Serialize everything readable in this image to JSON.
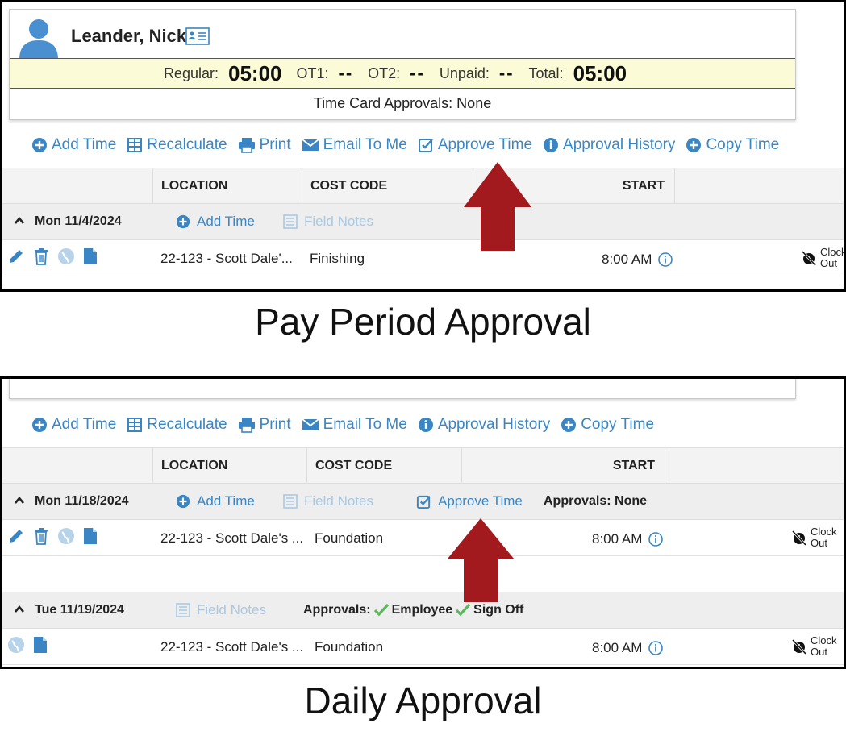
{
  "employee": {
    "name": "Leander, Nick",
    "regular_label": "Regular:",
    "regular_value": "05:00",
    "ot1_label": "OT1:",
    "ot1_value": "--",
    "ot2_label": "OT2:",
    "ot2_value": "--",
    "unpaid_label": "Unpaid:",
    "unpaid_value": "--",
    "total_label": "Total:",
    "total_value": "05:00",
    "approvals_line": "Time Card Approvals: None"
  },
  "toolbar1": {
    "add_time": "Add Time",
    "recalculate": "Recalculate",
    "print": "Print",
    "email_to_me": "Email To Me",
    "approve_time": "Approve Time",
    "approval_history": "Approval History",
    "copy_time": "Copy Time"
  },
  "toolbar2": {
    "add_time": "Add Time",
    "recalculate": "Recalculate",
    "print": "Print",
    "email_to_me": "Email To Me",
    "approval_history": "Approval History",
    "copy_time": "Copy Time"
  },
  "columns": {
    "location": "LOCATION",
    "cost_code": "COST CODE",
    "start": "START"
  },
  "panel1": {
    "day": {
      "date": "Mon 11/4/2024",
      "add_time": "Add Time",
      "field_notes": "Field Notes"
    },
    "entry": {
      "location": "22-123 - Scott Dale'...",
      "cost_code": "Finishing",
      "start": "8:00 AM",
      "clock_out_1": "Clock",
      "clock_out_2": "Out"
    }
  },
  "panel2": {
    "day1": {
      "date": "Mon 11/18/2024",
      "add_time": "Add Time",
      "field_notes": "Field Notes",
      "approve_time": "Approve Time",
      "approvals": "Approvals: None"
    },
    "entry1": {
      "location": "22-123 - Scott Dale's ...",
      "cost_code": "Foundation",
      "start": "8:00 AM",
      "clock_out_1": "Clock",
      "clock_out_2": "Out"
    },
    "day2": {
      "date": "Tue 11/19/2024",
      "field_notes": "Field Notes",
      "approvals_label": "Approvals:",
      "approval_employee": "Employee",
      "approval_signoff": "Sign Off"
    },
    "entry2": {
      "location": "22-123 - Scott Dale's ...",
      "cost_code": "Foundation",
      "start": "8:00 AM",
      "clock_out_1": "Clock",
      "clock_out_2": "Out"
    }
  },
  "captions": {
    "pay_period": "Pay Period Approval",
    "daily": "Daily Approval"
  },
  "colors": {
    "link_blue": "#3a86c4",
    "arrow_red": "#a31a1e",
    "check_green": "#5cb85c",
    "hours_bg": "#fbfbd7"
  }
}
